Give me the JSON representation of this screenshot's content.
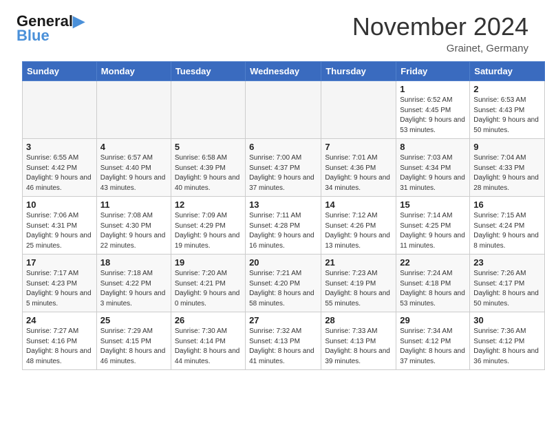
{
  "header": {
    "logo_line1": "General",
    "logo_line2": "Blue",
    "month": "November 2024",
    "location": "Grainet, Germany"
  },
  "weekdays": [
    "Sunday",
    "Monday",
    "Tuesday",
    "Wednesday",
    "Thursday",
    "Friday",
    "Saturday"
  ],
  "weeks": [
    [
      {
        "day": "",
        "info": "",
        "empty": true
      },
      {
        "day": "",
        "info": "",
        "empty": true
      },
      {
        "day": "",
        "info": "",
        "empty": true
      },
      {
        "day": "",
        "info": "",
        "empty": true
      },
      {
        "day": "",
        "info": "",
        "empty": true
      },
      {
        "day": "1",
        "info": "Sunrise: 6:52 AM\nSunset: 4:45 PM\nDaylight: 9 hours and 53 minutes."
      },
      {
        "day": "2",
        "info": "Sunrise: 6:53 AM\nSunset: 4:43 PM\nDaylight: 9 hours and 50 minutes."
      }
    ],
    [
      {
        "day": "3",
        "info": "Sunrise: 6:55 AM\nSunset: 4:42 PM\nDaylight: 9 hours and 46 minutes."
      },
      {
        "day": "4",
        "info": "Sunrise: 6:57 AM\nSunset: 4:40 PM\nDaylight: 9 hours and 43 minutes."
      },
      {
        "day": "5",
        "info": "Sunrise: 6:58 AM\nSunset: 4:39 PM\nDaylight: 9 hours and 40 minutes."
      },
      {
        "day": "6",
        "info": "Sunrise: 7:00 AM\nSunset: 4:37 PM\nDaylight: 9 hours and 37 minutes."
      },
      {
        "day": "7",
        "info": "Sunrise: 7:01 AM\nSunset: 4:36 PM\nDaylight: 9 hours and 34 minutes."
      },
      {
        "day": "8",
        "info": "Sunrise: 7:03 AM\nSunset: 4:34 PM\nDaylight: 9 hours and 31 minutes."
      },
      {
        "day": "9",
        "info": "Sunrise: 7:04 AM\nSunset: 4:33 PM\nDaylight: 9 hours and 28 minutes."
      }
    ],
    [
      {
        "day": "10",
        "info": "Sunrise: 7:06 AM\nSunset: 4:31 PM\nDaylight: 9 hours and 25 minutes."
      },
      {
        "day": "11",
        "info": "Sunrise: 7:08 AM\nSunset: 4:30 PM\nDaylight: 9 hours and 22 minutes."
      },
      {
        "day": "12",
        "info": "Sunrise: 7:09 AM\nSunset: 4:29 PM\nDaylight: 9 hours and 19 minutes."
      },
      {
        "day": "13",
        "info": "Sunrise: 7:11 AM\nSunset: 4:28 PM\nDaylight: 9 hours and 16 minutes."
      },
      {
        "day": "14",
        "info": "Sunrise: 7:12 AM\nSunset: 4:26 PM\nDaylight: 9 hours and 13 minutes."
      },
      {
        "day": "15",
        "info": "Sunrise: 7:14 AM\nSunset: 4:25 PM\nDaylight: 9 hours and 11 minutes."
      },
      {
        "day": "16",
        "info": "Sunrise: 7:15 AM\nSunset: 4:24 PM\nDaylight: 9 hours and 8 minutes."
      }
    ],
    [
      {
        "day": "17",
        "info": "Sunrise: 7:17 AM\nSunset: 4:23 PM\nDaylight: 9 hours and 5 minutes."
      },
      {
        "day": "18",
        "info": "Sunrise: 7:18 AM\nSunset: 4:22 PM\nDaylight: 9 hours and 3 minutes."
      },
      {
        "day": "19",
        "info": "Sunrise: 7:20 AM\nSunset: 4:21 PM\nDaylight: 9 hours and 0 minutes."
      },
      {
        "day": "20",
        "info": "Sunrise: 7:21 AM\nSunset: 4:20 PM\nDaylight: 8 hours and 58 minutes."
      },
      {
        "day": "21",
        "info": "Sunrise: 7:23 AM\nSunset: 4:19 PM\nDaylight: 8 hours and 55 minutes."
      },
      {
        "day": "22",
        "info": "Sunrise: 7:24 AM\nSunset: 4:18 PM\nDaylight: 8 hours and 53 minutes."
      },
      {
        "day": "23",
        "info": "Sunrise: 7:26 AM\nSunset: 4:17 PM\nDaylight: 8 hours and 50 minutes."
      }
    ],
    [
      {
        "day": "24",
        "info": "Sunrise: 7:27 AM\nSunset: 4:16 PM\nDaylight: 8 hours and 48 minutes."
      },
      {
        "day": "25",
        "info": "Sunrise: 7:29 AM\nSunset: 4:15 PM\nDaylight: 8 hours and 46 minutes."
      },
      {
        "day": "26",
        "info": "Sunrise: 7:30 AM\nSunset: 4:14 PM\nDaylight: 8 hours and 44 minutes."
      },
      {
        "day": "27",
        "info": "Sunrise: 7:32 AM\nSunset: 4:13 PM\nDaylight: 8 hours and 41 minutes."
      },
      {
        "day": "28",
        "info": "Sunrise: 7:33 AM\nSunset: 4:13 PM\nDaylight: 8 hours and 39 minutes."
      },
      {
        "day": "29",
        "info": "Sunrise: 7:34 AM\nSunset: 4:12 PM\nDaylight: 8 hours and 37 minutes."
      },
      {
        "day": "30",
        "info": "Sunrise: 7:36 AM\nSunset: 4:12 PM\nDaylight: 8 hours and 36 minutes."
      }
    ]
  ]
}
